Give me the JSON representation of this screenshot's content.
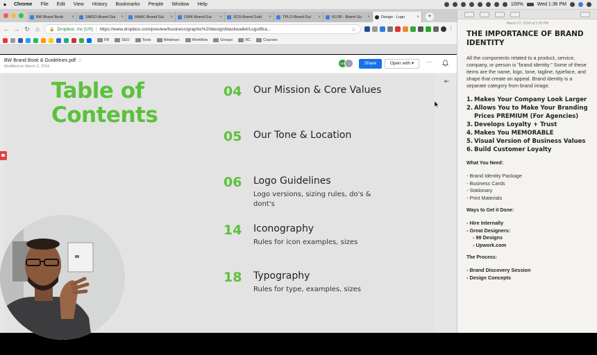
{
  "menubar": {
    "apple": "",
    "app": "Chrome",
    "menus": [
      "File",
      "Edit",
      "View",
      "History",
      "Bookmarks",
      "People",
      "Window",
      "Help"
    ],
    "battery": "100%",
    "clock": "Wed 1:36 PM"
  },
  "tabs": [
    {
      "label": "BW Brand Book",
      "active": false
    },
    {
      "label": "SMGO-Brand Gui",
      "active": false
    },
    {
      "label": "HNAC-Brand Gui",
      "active": false
    },
    {
      "label": "GWK-Brand Gui",
      "active": false
    },
    {
      "label": "SCS-Brand Guid",
      "active": false
    },
    {
      "label": "TPLO-Brand Gui",
      "active": false
    },
    {
      "label": "KOJR - Brand Gu",
      "active": false
    },
    {
      "label": "Design - Logo",
      "active": true
    }
  ],
  "omnibox": {
    "org": "Dropbox, Inc [US]",
    "url": "https://www.dropbox.com/preview/business/graphic%20design/blackwallet/Logo/Bra..."
  },
  "bookmarks": {
    "folders": [
      "FB",
      "SEO",
      "Tools",
      "Webinars",
      "Workflow",
      "Groups",
      "RC",
      "Courses"
    ]
  },
  "dropbox": {
    "doc_title": "BW Brand Book & Guidelines.pdf",
    "modified": "Modified on March 2, 2018",
    "share_label": "Share",
    "open_label": "Open with ▾",
    "more_label": "···",
    "avatar_initials": "BW"
  },
  "pdf": {
    "title_line1": "Table of",
    "title_line2": "Contents",
    "items": [
      {
        "num": "04",
        "head": "Our Mission & Core Values",
        "sub": ""
      },
      {
        "num": "05",
        "head": "Our Tone & Location",
        "sub": ""
      },
      {
        "num": "06",
        "head": "Logo Guidelines",
        "sub": "Logo versions, sizing rules, do's & dont's"
      },
      {
        "num": "14",
        "head": "Iconography",
        "sub": "Rules for icon examples, sizes"
      },
      {
        "num": "18",
        "head": "Typography",
        "sub": "Rules for type, examples, sizes"
      }
    ]
  },
  "notes": {
    "date": "March 27, 2018 at 1:35 PM",
    "title": "THE IMPORTANCE OF BRAND IDENTITY",
    "paragraph": "All the components related to a product, service, company, or person is \"brand identity.\" Some of these items are the name, logo, tone, tagline, typeface, and shape that create an appeal. Brand identity is a separate category from brand image.",
    "list": [
      "Makes Your Company Look Larger",
      "Allows You to Make Your Branding Prices PREMIUM (For Agencies)",
      "Develops Loyalty + Trust",
      "Makes You MEMORABLE",
      "Visual Version of Business Values",
      "Build Customer Loyalty"
    ],
    "need_head": "What You Need:",
    "need": [
      "Brand Identity Package",
      "Business Cards",
      "Stationary",
      "Print Materials"
    ],
    "ways_head": "Ways to Get it Done:",
    "ways_1": "Hire Internally",
    "ways_2": "Great Designers:",
    "ways_2a": "99 Designs",
    "ways_2b": "Upwork.com",
    "process_head": "The Process:",
    "process_1": "Brand Discovery Session",
    "process_2": "Design Concepts"
  },
  "colors": {
    "accent_green": "#5cc13c",
    "share_blue": "#1672e6"
  }
}
